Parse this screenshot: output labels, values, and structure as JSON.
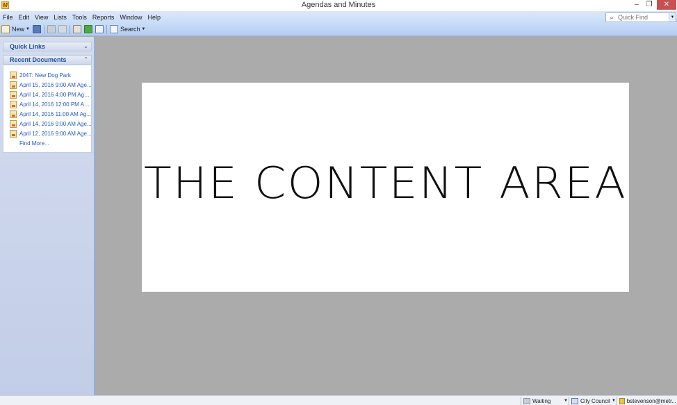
{
  "window": {
    "title": "Agendas and Minutes",
    "app_icon_letter": "M",
    "minimize": "–",
    "maximize": "❐",
    "close": "✕"
  },
  "menu": [
    "File",
    "Edit",
    "View",
    "Lists",
    "Tools",
    "Reports",
    "Window",
    "Help"
  ],
  "toolbar": {
    "new_label": "New",
    "search_label": "Search"
  },
  "quick_find": {
    "placeholder": "Quick Find"
  },
  "sidebar": {
    "quick_links_title": "Quick Links",
    "recent_documents_title": "Recent Documents",
    "recent_documents": [
      "2047: New Dog Park",
      "April 15, 2016 9:00 AM Age...",
      "April 14, 2016 4:00 PM Age...",
      "April 14, 2016 12:00 PM Ag...",
      "April 14, 2016 11:00 AM Ag...",
      "April 14, 2016 9:00 AM Age...",
      "April 12, 2016 9:00 AM Age..."
    ],
    "find_more": "Find More..."
  },
  "content": {
    "placeholder_text": "THE CONTENT AREA"
  },
  "statusbar": {
    "status": "Waiting",
    "meeting_body": "City Council",
    "user": "bstevenson@metr..."
  },
  "colors": {
    "link_blue": "#2458c5",
    "header_blue": "#1f4fa0",
    "close_red": "#c75050",
    "workspace_gray": "#ababab"
  }
}
